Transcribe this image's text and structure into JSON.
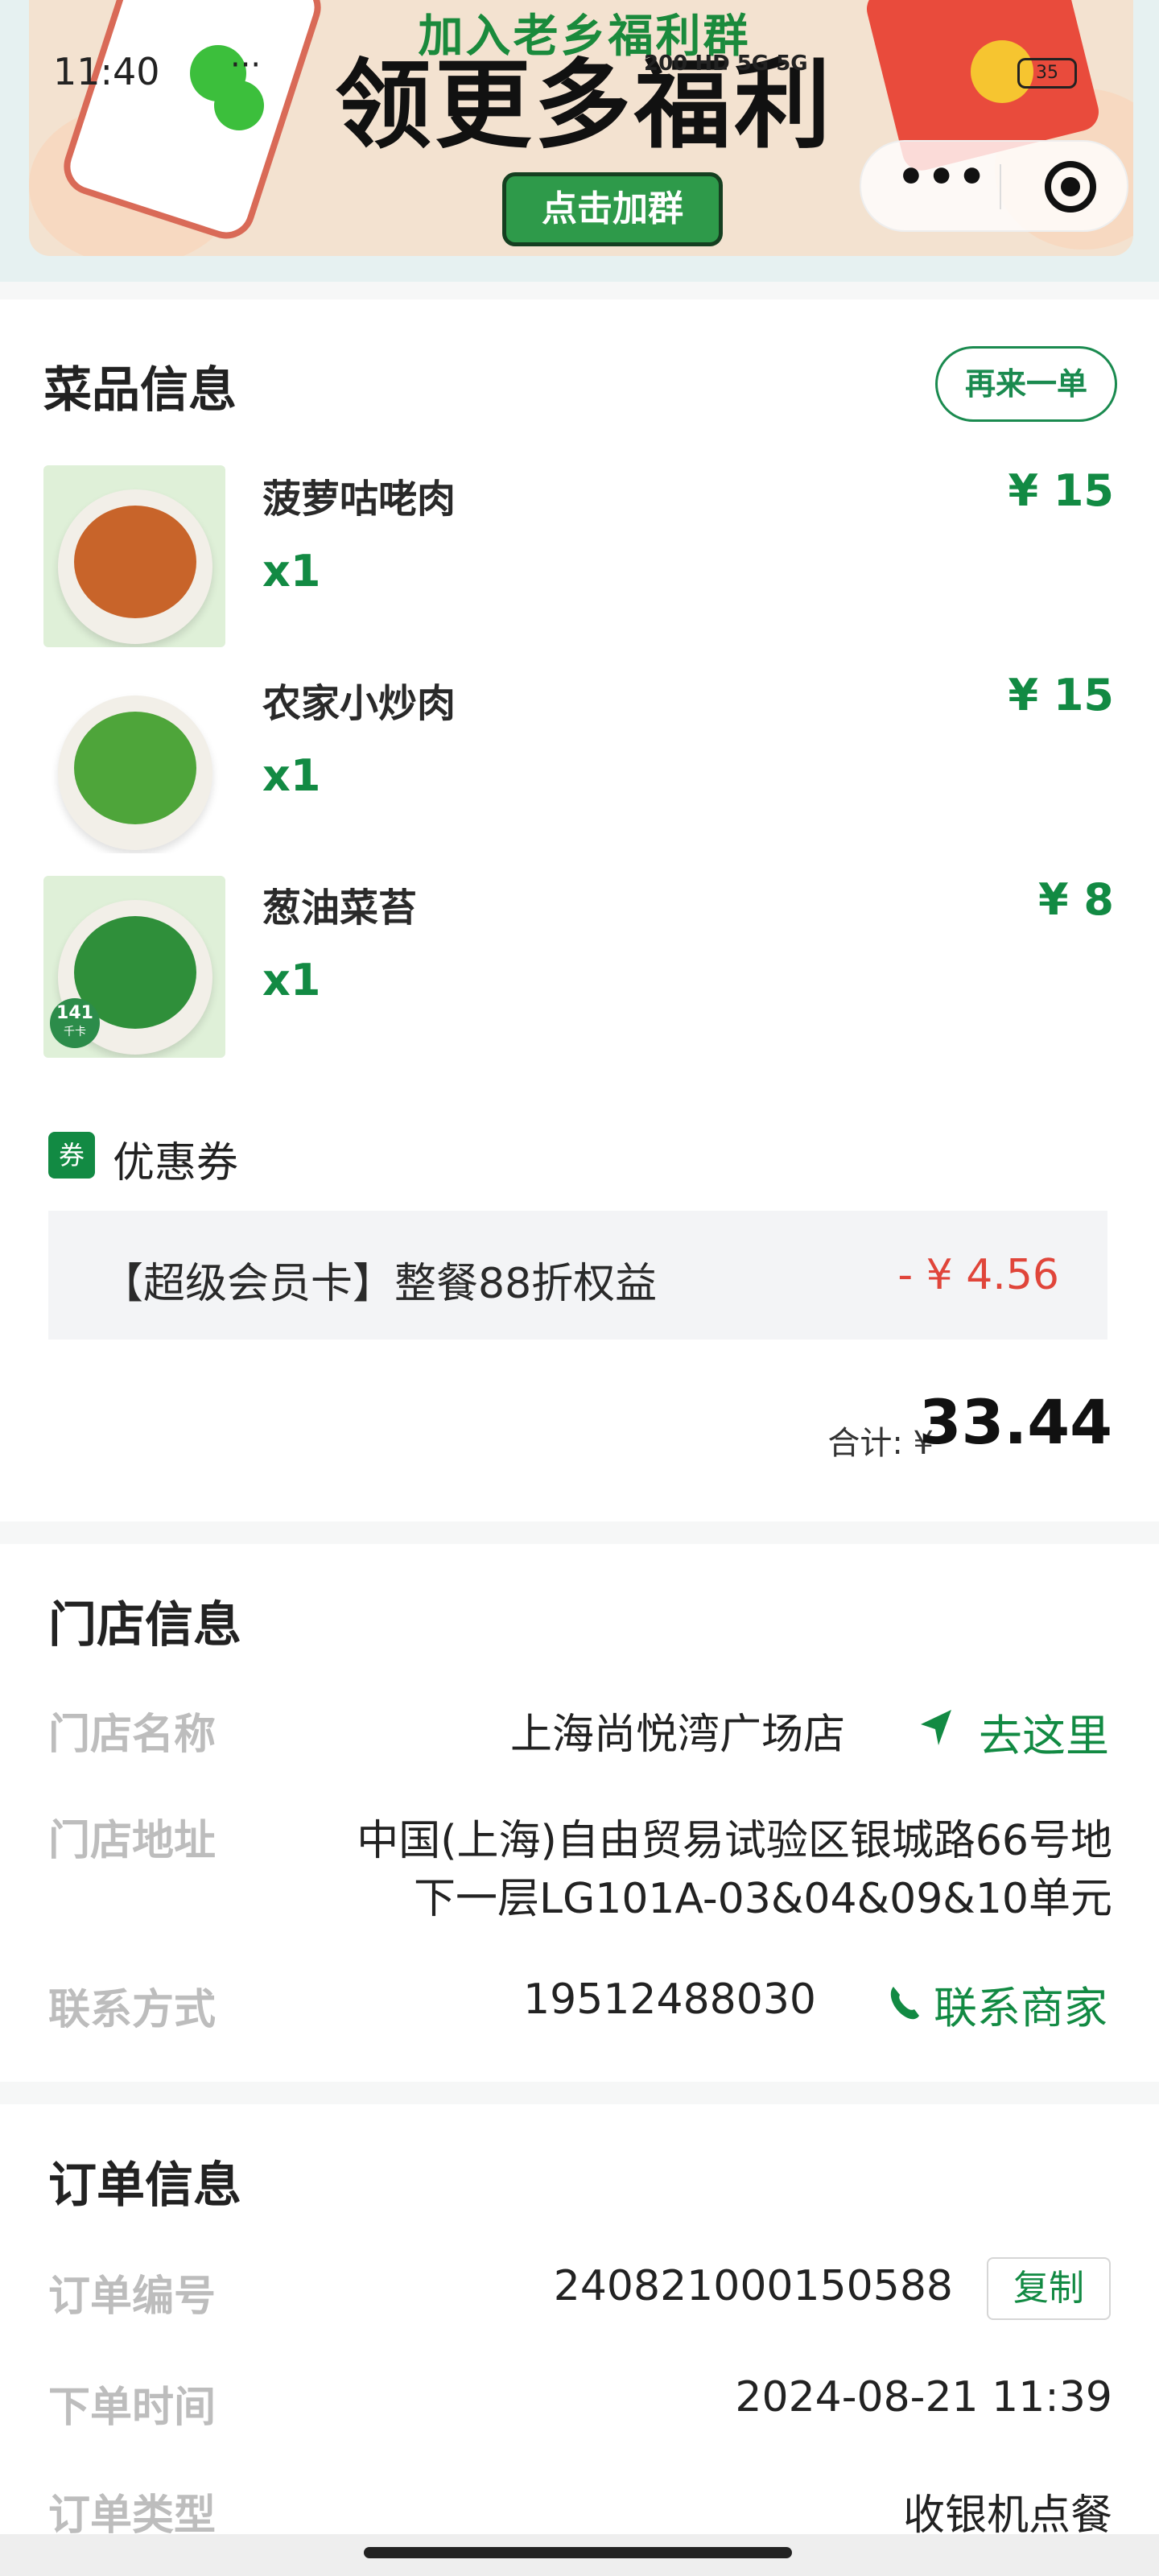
{
  "status_bar": {
    "time": "11:40",
    "dots": "···",
    "indicators": "200 HD 5G 5G",
    "battery": "35"
  },
  "banner": {
    "line1": "加入老乡福利群",
    "line2": "领更多福利",
    "cta": "点击加群"
  },
  "capsule": {
    "more": "•••"
  },
  "dishes_section": {
    "title": "菜品信息",
    "reorder_label": "再来一单",
    "items": [
      {
        "name": "菠萝咕咾肉",
        "qty": "x1",
        "price": "¥ 15"
      },
      {
        "name": "农家小炒肉",
        "qty": "x1",
        "price": "¥ 15"
      },
      {
        "name": "葱油菜苔",
        "qty": "x1",
        "price": "¥ 8"
      }
    ],
    "badge_text": "141",
    "badge_sub": "千卡"
  },
  "coupon": {
    "icon_text": "券",
    "label": "优惠券",
    "name": "【超级会员卡】整餐88折权益",
    "amount": "- ¥ 4.56"
  },
  "total": {
    "label": "合计: ¥",
    "value": "33.44"
  },
  "store_section": {
    "title": "门店信息",
    "name_label": "门店名称",
    "name_value": "上海尚悦湾广场店",
    "go_label": "去这里",
    "address_label": "门店地址",
    "address_line1": "中国(上海)自由贸易试验区银城路66号地",
    "address_line2": "下一层LG101A-03&04&09&10单元",
    "contact_label": "联系方式",
    "contact_value": "19512488030",
    "contact_action": "联系商家"
  },
  "order_section": {
    "title": "订单信息",
    "number_label": "订单编号",
    "number_value": "240821000150588",
    "copy_label": "复制",
    "time_label": "下单时间",
    "time_value": "2024-08-21 11:39",
    "type_label": "订单类型",
    "type_value": "收银机点餐"
  },
  "colors": {
    "brand_green": "#128a43",
    "discount_red": "#e0453a",
    "label_gray": "#bdbdbd"
  }
}
